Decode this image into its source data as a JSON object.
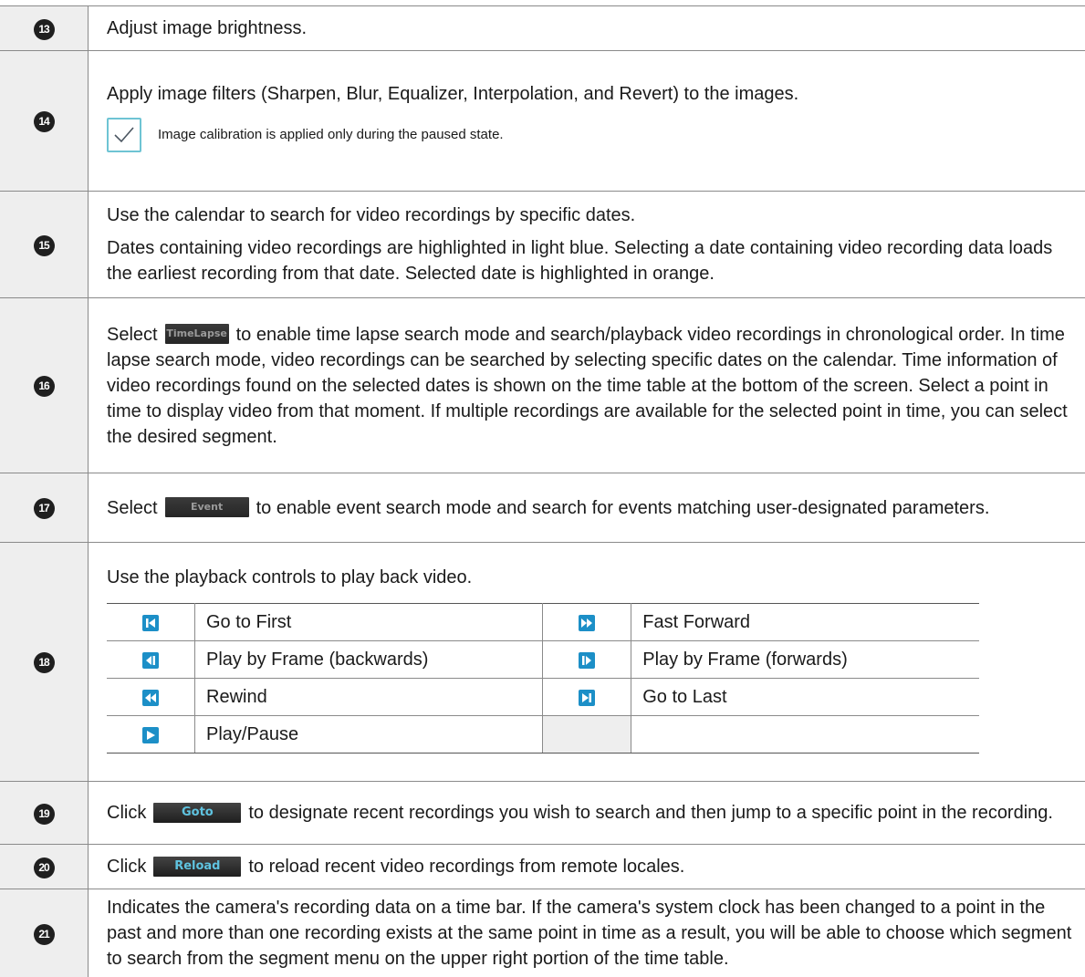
{
  "rows": [
    {
      "num": "13",
      "text": "Adjust image brightness."
    },
    {
      "num": "14",
      "text": "Apply image filters (Sharpen, Blur, Equalizer, Interpolation, and Revert) to the images.",
      "note": "Image calibration is applied only during the paused state."
    },
    {
      "num": "15",
      "text1": "Use the calendar to search for video recordings by specific dates.",
      "text2": "Dates containing video recordings are highlighted in light blue. Selecting a date containing video recording data loads the earliest recording from that date. Selected date is highlighted in orange."
    },
    {
      "num": "16",
      "pre": "Select",
      "button": "TimeLapse",
      "post": "to enable time lapse search mode and search/playback video recordings in chronological order. In time lapse search mode, video recordings can be searched by selecting specific dates on the calendar. Time information of video recordings found on the selected dates is shown on the time table at the bottom of the screen. Select a point in time to display video from that moment. If multiple recordings are available for the selected point in time, you can select the desired segment."
    },
    {
      "num": "17",
      "pre": "Select",
      "button": "Event",
      "post": "to enable event search mode and search for events matching user-designated parameters."
    },
    {
      "num": "18",
      "text": "Use the playback controls to play back video.",
      "controls": [
        {
          "left_icon": "go-to-first-icon",
          "left": "Go to First",
          "right_icon": "fast-forward-icon",
          "right": "Fast Forward"
        },
        {
          "left_icon": "frame-back-icon",
          "left": "Play by Frame (backwards)",
          "right_icon": "frame-forward-icon",
          "right": "Play by Frame (forwards)"
        },
        {
          "left_icon": "rewind-icon",
          "left": "Rewind",
          "right_icon": "go-to-last-icon",
          "right": "Go to Last"
        },
        {
          "left_icon": "play-pause-icon",
          "left": "Play/Pause",
          "right_icon": "",
          "right": ""
        }
      ]
    },
    {
      "num": "19",
      "pre": "Click",
      "button": "Goto",
      "post": "to designate recent recordings you wish to search and then jump to a specific point in the recording."
    },
    {
      "num": "20",
      "pre": "Click",
      "button": "Reload",
      "post": "to reload recent video recordings from remote locales."
    },
    {
      "num": "21",
      "text": "Indicates the camera's recording data on a time bar. If the camera's system clock has been changed to a point in the past and more than one recording exists at the same point in time as a result, you will be able to choose which segment to search from the segment menu on the upper right portion of the time table."
    }
  ],
  "colors": {
    "icon_blue": "#1c8fc7",
    "check_teal": "#6ec4d4",
    "button_dark": "#2b2b2b",
    "button_text_blue": "#5fc3e0"
  }
}
